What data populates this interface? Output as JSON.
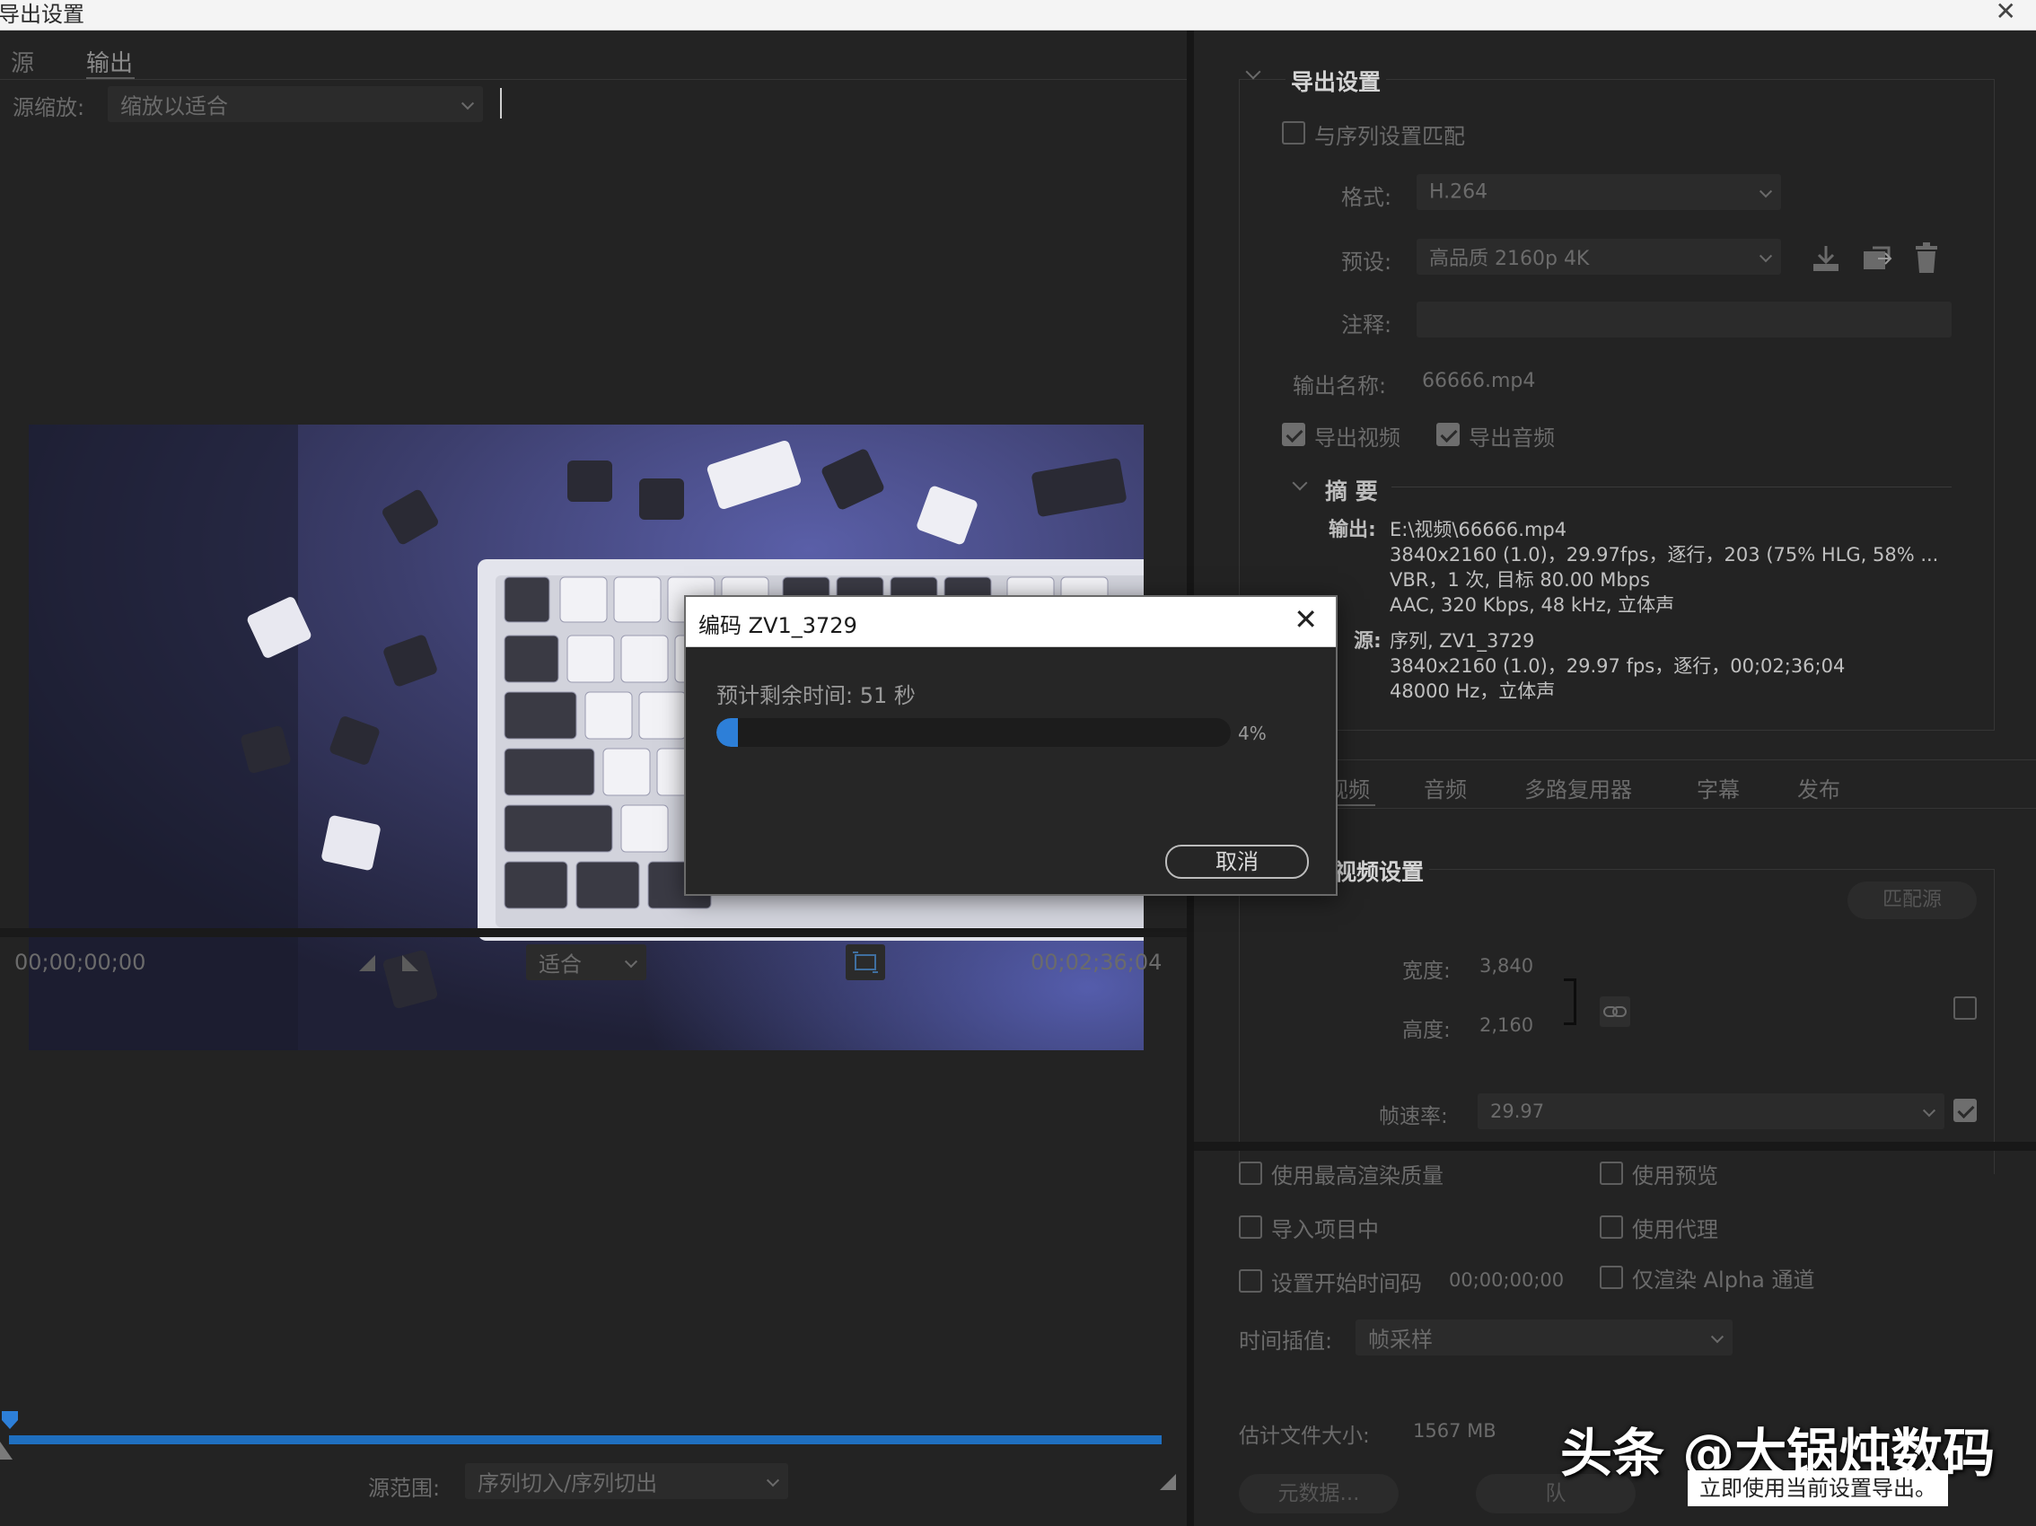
{
  "window": {
    "title": "导出设置"
  },
  "left": {
    "tabs": [
      {
        "label": "源"
      },
      {
        "label": "输出"
      }
    ],
    "source_scale": {
      "label": "源缩放:",
      "value": "缩放以适合"
    },
    "timeline": {
      "timecode_start": "00;00;00;00",
      "timecode_end": "00;02;36;04",
      "zoom": "适合",
      "source_range": {
        "label": "源范围:",
        "value": "序列切入/序列切出"
      }
    }
  },
  "right": {
    "export_settings": {
      "title": "导出设置",
      "match_sequence": "与序列设置匹配",
      "format": {
        "label": "格式:",
        "value": "H.264"
      },
      "preset": {
        "label": "预设:",
        "value": "高品质 2160p 4K"
      },
      "comments": {
        "label": "注释:",
        "value": ""
      },
      "output_name": {
        "label": "输出名称:",
        "value": "66666.mp4"
      },
      "export_video": "导出视频",
      "export_audio": "导出音频",
      "summary": {
        "title": "摘 要",
        "output_label": "输出:",
        "output_lines": [
          "E:\\视频\\66666.mp4",
          "3840x2160 (1.0)，29.97fps，逐行，203 (75% HLG, 58% ...",
          "VBR，1 次, 目标 80.00 Mbps",
          "AAC, 320 Kbps, 48  kHz, 立体声"
        ],
        "source_label": "源:",
        "source_lines": [
          "序列, ZV1_3729",
          "3840x2160 (1.0)，29.97 fps，逐行，00;02;36;04",
          "48000 Hz，立体声"
        ]
      }
    },
    "tabs": [
      {
        "label": "视频"
      },
      {
        "label": "音频"
      },
      {
        "label": "多路复用器"
      },
      {
        "label": "字幕"
      },
      {
        "label": "发布"
      }
    ],
    "video_settings": {
      "title": "视频设置",
      "match_source": "匹配源",
      "width": {
        "label": "宽度:",
        "value": "3,840"
      },
      "height": {
        "label": "高度:",
        "value": "2,160"
      },
      "frame_rate": {
        "label": "帧速率:",
        "value": "29.97"
      }
    },
    "options": {
      "max_render": "使用最高渲染质量",
      "use_previews": "使用预览",
      "import_project": "导入项目中",
      "use_proxies": "使用代理",
      "set_start_tc": "设置开始时间码",
      "start_tc_value": "00;00;00;00",
      "alpha_only": "仅渲染 Alpha 通道",
      "time_interp": {
        "label": "时间插值:",
        "value": "帧采样"
      },
      "file_size": {
        "label": "估计文件大小:",
        "value": "1567 MB"
      },
      "metadata_btn": "元数据...",
      "queue_btn": "队"
    }
  },
  "encode_dialog": {
    "title": "编码 ZV1_3729",
    "remaining": "预计剩余时间: 51 秒",
    "percent_label": "4%",
    "progress": 0.04,
    "cancel": "取消"
  },
  "watermark": "头条 @大锅炖数码",
  "toast": "立即使用当前设置导出。",
  "colors": {
    "accent": "#2d7fd8",
    "panel": "#232323",
    "divider": "#161616"
  }
}
